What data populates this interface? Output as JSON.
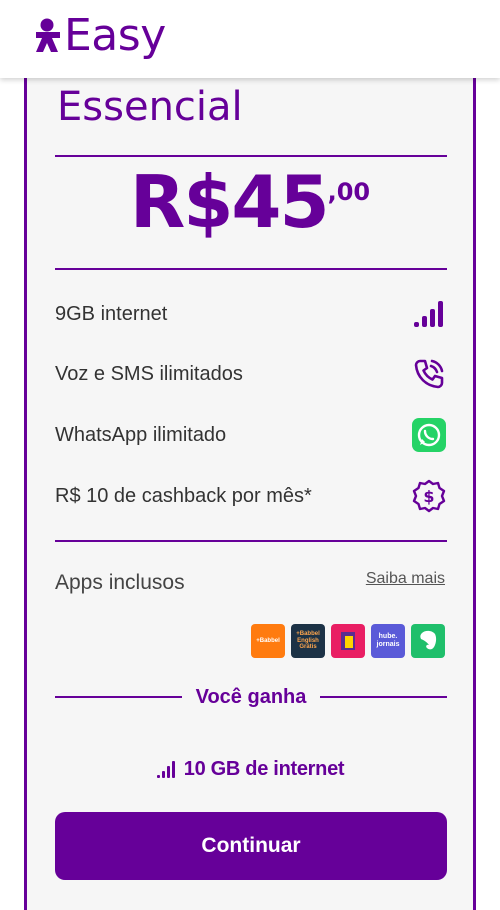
{
  "header": {
    "logo_text": "Easy"
  },
  "plan": {
    "name": "Essencial",
    "price_main": "R$45",
    "price_cents": ",00"
  },
  "benefits": [
    {
      "label": "9GB internet",
      "icon": "signal-bars-icon"
    },
    {
      "label": "Voz e SMS ilimitados",
      "icon": "phone-call-icon"
    },
    {
      "label": "WhatsApp ilimitado",
      "icon": "whatsapp-icon"
    },
    {
      "label": "R$ 10 de cashback por mês*",
      "icon": "dollar-badge-icon"
    }
  ],
  "apps": {
    "label": "Apps inclusos",
    "saiba_mais": "Saiba mais",
    "items": [
      {
        "name": "babbel",
        "text": "+Babbel",
        "color": "#ff7b0f"
      },
      {
        "name": "babbel-english",
        "text": "+Babbel English Grátis",
        "color": "#1c3246"
      },
      {
        "name": "j-app",
        "text": "",
        "color": "#e91e63"
      },
      {
        "name": "hube-jornais",
        "text": "hube. jornais",
        "color": "#5a5ad8"
      },
      {
        "name": "evernote",
        "text": "",
        "color": "#1fbf6b"
      }
    ]
  },
  "bonus": {
    "heading": "Você ganha",
    "text": "10 GB de internet"
  },
  "cta": {
    "label": "Continuar"
  },
  "colors": {
    "brand": "#660099",
    "whatsapp": "#25d366"
  }
}
